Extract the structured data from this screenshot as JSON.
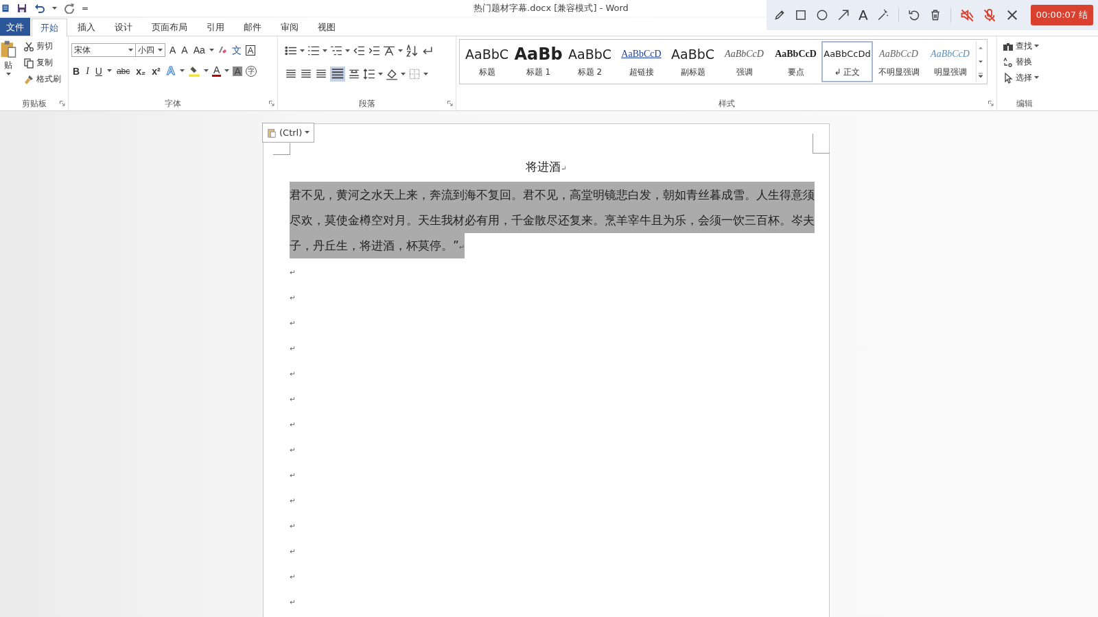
{
  "quick_access": {
    "customize": "="
  },
  "window": {
    "title": "热门题材字幕.docx [兼容模式] - Word"
  },
  "recorder": {
    "text_tool": "A",
    "timer": "00:00:07 结"
  },
  "tabs": [
    {
      "label": "文件",
      "kind": "file",
      "selected": false
    },
    {
      "label": "开始",
      "kind": "tab",
      "selected": true
    },
    {
      "label": "插入",
      "kind": "tab",
      "selected": false
    },
    {
      "label": "设计",
      "kind": "tab",
      "selected": false
    },
    {
      "label": "页面布局",
      "kind": "tab",
      "selected": false
    },
    {
      "label": "引用",
      "kind": "tab",
      "selected": false
    },
    {
      "label": "邮件",
      "kind": "tab",
      "selected": false
    },
    {
      "label": "审阅",
      "kind": "tab",
      "selected": false
    },
    {
      "label": "视图",
      "kind": "tab",
      "selected": false
    }
  ],
  "clipboard": {
    "paste": "贴",
    "cut": "剪切",
    "copy": "复制",
    "format_painter": "格式刷",
    "group_label": "剪贴板"
  },
  "font": {
    "font_name": "宋体",
    "font_size": "小四",
    "grow": "A",
    "shrink": "A",
    "change_case": "Aa",
    "phonetic": "文",
    "border_char": "A",
    "bold": "B",
    "italic": "I",
    "underline": "U",
    "strikethrough": "abc",
    "subscript": "x₂",
    "superscript": "x²",
    "text_effects": "A",
    "font_color": "A",
    "char_shading": "A",
    "enclose": "字",
    "group_label": "字体"
  },
  "paragraph": {
    "justify_selected": true,
    "group_label": "段落"
  },
  "styles": {
    "items": [
      {
        "preview": "AaBbC",
        "label": "标题",
        "kind": "title",
        "selected": false
      },
      {
        "preview": "AaBb",
        "label": "标题 1",
        "kind": "heading1",
        "selected": false
      },
      {
        "preview": "AaBbC",
        "label": "标题 2",
        "kind": "heading2",
        "selected": false
      },
      {
        "preview": "AaBbCcD",
        "label": "超链接",
        "kind": "link",
        "selected": false
      },
      {
        "preview": "AaBbC",
        "label": "副标题",
        "kind": "subtitle",
        "selected": false
      },
      {
        "preview": "AaBbCcD",
        "label": "强调",
        "kind": "emphasis",
        "selected": false
      },
      {
        "preview": "AaBbCcD",
        "label": "要点",
        "kind": "strong",
        "selected": false
      },
      {
        "preview": "AaBbCcDd",
        "label": "↲ 正文",
        "kind": "normal",
        "selected": true
      },
      {
        "preview": "AaBbCcD",
        "label": "不明显强调",
        "kind": "subtle",
        "selected": false
      },
      {
        "preview": "AaBbCcD",
        "label": "明显强调",
        "kind": "intense",
        "selected": false
      }
    ],
    "group_label": "样式"
  },
  "editing": {
    "find": "查找",
    "replace": "替换",
    "select": "选择",
    "group_label": "编辑"
  },
  "paste_options": {
    "label": "(Ctrl)"
  },
  "document": {
    "title": "将进酒",
    "title_mark": "↵",
    "body": "君不见，黄河之水天上来，奔流到海不复回。君不见，高堂明镜悲白发，朝如青丝暮成雪。人生得意须尽欢，莫使金樽空对月。天生我材必有用，千金散尽还复来。烹羊宰牛且为乐，会须一饮三百杯。岑夫子，丹丘生，将进酒，杯莫停。”",
    "body_mark": "↵",
    "body_selected": true,
    "empty_paragraphs": [
      "↵",
      "↵",
      "↵",
      "↵",
      "↵",
      "↵",
      "↵",
      "↵",
      "↵",
      "↵",
      "↵",
      "↵",
      "↵",
      "↵"
    ]
  }
}
